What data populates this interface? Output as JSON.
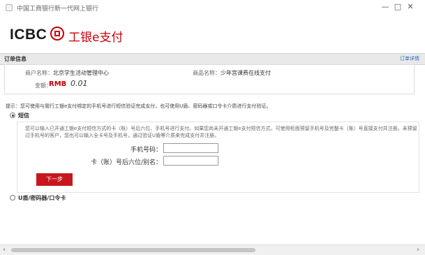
{
  "window": {
    "title": "中国工商银行新一代网上银行",
    "controls": {
      "minimize": "—",
      "restore": "□",
      "close": "✕"
    }
  },
  "logo": {
    "icbc": "ICBC",
    "brand": "工银e支付"
  },
  "order_section": {
    "label": "订单信息",
    "link": "订单详情"
  },
  "order": {
    "merchant_label": "商户名称：",
    "merchant_value": "北京学生活动管理中心",
    "product_label": "商品名称：",
    "product_value": "少年宫课费在线支付",
    "amount_label": "金额：",
    "currency": "RMB",
    "amount_value": "0.01"
  },
  "hint": "提示：您可使用与我行工银e支付绑定的手机号进行短信验证完成支付，也可使用U盾、密码器或口令卡介质进行支付验证。",
  "sms_option": {
    "label": "短信",
    "selected": true,
    "description": "您可以输入已开通工银e支付短信方式的卡（账）号后六位、手机号进行支付。如果您尚未开通工银e支付短信方式，可使用柜面预留手机号及完整卡（账）号直接支付并注册。未预留过手机号的客户，您也可以输入全卡号及手机号，通过验证U盾等介质来完成支付并注册。",
    "phone_label": "手机号码：",
    "phone_value": "",
    "card_label": "卡（账）号后六位/别名：",
    "card_value": "",
    "next_button": "下一步"
  },
  "ushield_option": {
    "label": "U盾/密码器/口令卡",
    "selected": false
  },
  "scrollbar": {
    "left_arrow": "‹",
    "right_arrow": "›"
  },
  "colors": {
    "brand_red": "#c7000b",
    "button_red": "#c8161e",
    "link_blue": "#2a6bc2"
  }
}
